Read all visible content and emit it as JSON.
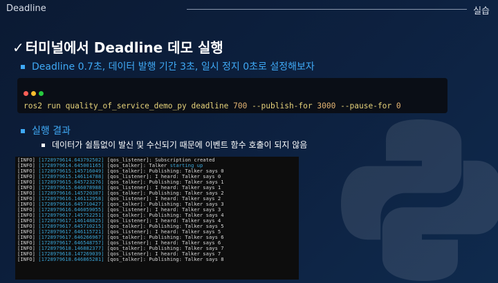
{
  "header": {
    "left": "Deadline",
    "right": "실습"
  },
  "title": {
    "check": "✓",
    "text": "터미널에서 Deadline 데모 실행"
  },
  "bullet1": "Deadline 0.7초, 데이터 발행 기간 3초, 일시 정지 0초로 설정해보자",
  "command": {
    "prefix": "ros2 run quality_of_service_demo_py deadline ",
    "deadline_ms": "700",
    "publish_flag": " --publish-for ",
    "publish_ms": "3000",
    "pause_flag": " --pause-for ",
    "pause_ms": "0"
  },
  "bullet2": "실행 결과",
  "sub_bullet": "데이터가 쉴틈없이 발신 및 수신되기 때문에 이벤트 함수 호출이 되지 않음",
  "terminal_lines": [
    {
      "lvl": "[INFO] ",
      "ts": "[1728979614.643792502]",
      "msg": " [qos_listener]: Subscription created",
      "hl": ""
    },
    {
      "lvl": "[INFO] ",
      "ts": "[1728979614.645001165]",
      "msg": " [qos_talker]: Talker ",
      "hl": "starting up"
    },
    {
      "lvl": "[INFO] ",
      "ts": "[1728979615.145716049]",
      "msg": " [qos_talker]: Publishing: Talker says 0",
      "hl": ""
    },
    {
      "lvl": "[INFO] ",
      "ts": "[1728979615.146114788]",
      "msg": " [qos_listener]: I heard: Talker says 0",
      "hl": ""
    },
    {
      "lvl": "[INFO] ",
      "ts": "[1728979615.645723276]",
      "msg": " [qos_talker]: Publishing: Talker says 1",
      "hl": ""
    },
    {
      "lvl": "[INFO] ",
      "ts": "[1728979615.646078988]",
      "msg": " [qos_listener]: I heard: Talker says 1",
      "hl": ""
    },
    {
      "lvl": "[INFO] ",
      "ts": "[1728979616.145720307]",
      "msg": " [qos_talker]: Publishing: Talker says 2",
      "hl": ""
    },
    {
      "lvl": "[INFO] ",
      "ts": "[1728979616.146112958]",
      "msg": " [qos_listener]: I heard: Talker says 2",
      "hl": ""
    },
    {
      "lvl": "[INFO] ",
      "ts": "[1728979616.645710427]",
      "msg": " [qos_talker]: Publishing: Talker says 3",
      "hl": ""
    },
    {
      "lvl": "[INFO] ",
      "ts": "[1728979616.646059055]",
      "msg": " [qos_listener]: I heard: Talker says 3",
      "hl": ""
    },
    {
      "lvl": "[INFO] ",
      "ts": "[1728979617.145752251]",
      "msg": " [qos_talker]: Publishing: Talker says 4",
      "hl": ""
    },
    {
      "lvl": "[INFO] ",
      "ts": "[1728979617.146148825]",
      "msg": " [qos_listener]: I heard: Talker says 4",
      "hl": ""
    },
    {
      "lvl": "[INFO] ",
      "ts": "[1728979617.645710215]",
      "msg": " [qos_talker]: Publishing: Talker says 5",
      "hl": ""
    },
    {
      "lvl": "[INFO] ",
      "ts": "[1728979617.646115721]",
      "msg": " [qos_listener]: I heard: Talker says 5",
      "hl": ""
    },
    {
      "lvl": "[INFO] ",
      "ts": "[1728979617.646266967]",
      "msg": " [qos_talker]: Publishing: Talker says 6",
      "hl": ""
    },
    {
      "lvl": "[INFO] ",
      "ts": "[1728979617.646548757]",
      "msg": " [qos_listener]: I heard: Talker says 6",
      "hl": ""
    },
    {
      "lvl": "[INFO] ",
      "ts": "[1728979618.146882377]",
      "msg": " [qos_talker]: Publishing: Talker says 7",
      "hl": ""
    },
    {
      "lvl": "[INFO] ",
      "ts": "[1728979618.147269039]",
      "msg": " [qos_listener]: I heard: Talker says 7",
      "hl": ""
    },
    {
      "lvl": "[INFO] ",
      "ts": "[1728979618.646865281]",
      "msg": " [qos_talker]: Publishing: Talker says 8",
      "hl": ""
    }
  ],
  "colors": {
    "background": "#0d2140",
    "accent_blue": "#3fa9f5",
    "terminal_timestamp": "#3aa5d9",
    "code_text": "#e6d27a"
  }
}
